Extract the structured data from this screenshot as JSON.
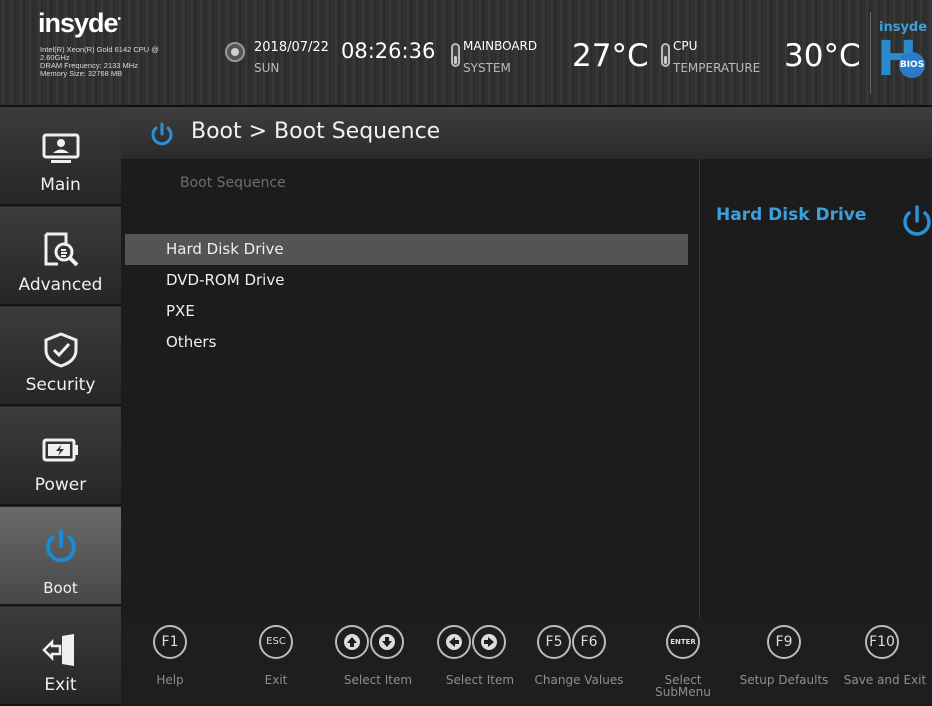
{
  "header": {
    "logo": "insyde",
    "cpu_info": "Intel(R) Xeon(R) Gold 6142 CPU @",
    "cpu_speed": "2.60GHz",
    "dram": "DRAM Frequency: 2133 MHz",
    "memory": "Memory Size: 32768 MB",
    "date": "2018/07/22",
    "day": "SUN",
    "time": "08:26:36",
    "mainboard_label": "MAINBOARD",
    "system_label": "SYSTEM",
    "system_temp": "27°C",
    "cpu_label": "CPU",
    "temperature_label": "TEMPERATURE",
    "cpu_temp": "30°C",
    "brand_top": "insyde",
    "brand_h": "H",
    "brand_bios": "BIOS"
  },
  "sidebar": {
    "items": [
      {
        "label": "Main",
        "icon": "monitor-icon"
      },
      {
        "label": "Advanced",
        "icon": "document-search-icon"
      },
      {
        "label": "Security",
        "icon": "shield-check-icon"
      },
      {
        "label": "Power",
        "icon": "battery-icon"
      },
      {
        "label": "Boot",
        "icon": "power-icon",
        "active": true
      },
      {
        "label": "Exit",
        "icon": "exit-door-icon"
      }
    ]
  },
  "page": {
    "title": "Boot > Boot Sequence",
    "section_label": "Boot Sequence",
    "boot_items": [
      "Hard Disk Drive",
      "DVD-ROM Drive",
      "PXE",
      "Others"
    ],
    "selected_index": 0
  },
  "help": {
    "title": "Hard Disk Drive"
  },
  "footer": {
    "keys": [
      {
        "key": "F1",
        "label": "Help"
      },
      {
        "key": "ESC",
        "label": "Exit"
      },
      {
        "key": "up-arrow",
        "label": "Select Item"
      },
      {
        "key": "left-right-arrow",
        "label": "Select Item"
      },
      {
        "key": "F5/F6",
        "label": "Change Values"
      },
      {
        "key": "ENTER",
        "label": "Select SubMenu"
      },
      {
        "key": "F9",
        "label": "Setup Defaults"
      },
      {
        "key": "F10",
        "label": "Save and Exit"
      }
    ],
    "f1": "F1",
    "esc": "ESC",
    "f5": "F5",
    "f6": "F6",
    "enter": "ENTER",
    "f9": "F9",
    "f10": "F10",
    "help_label": "Help",
    "exit_label": "Exit",
    "select_item_label": "Select Item",
    "change_values_label": "Change Values",
    "select_label": "Select",
    "submenu_label": "SubMenu",
    "setup_defaults_label": "Setup Defaults",
    "save_exit_label": "Save and Exit"
  },
  "colors": {
    "accent": "#3da0dc",
    "selected_row": "#545454",
    "section_label": "#6e6e6e"
  }
}
